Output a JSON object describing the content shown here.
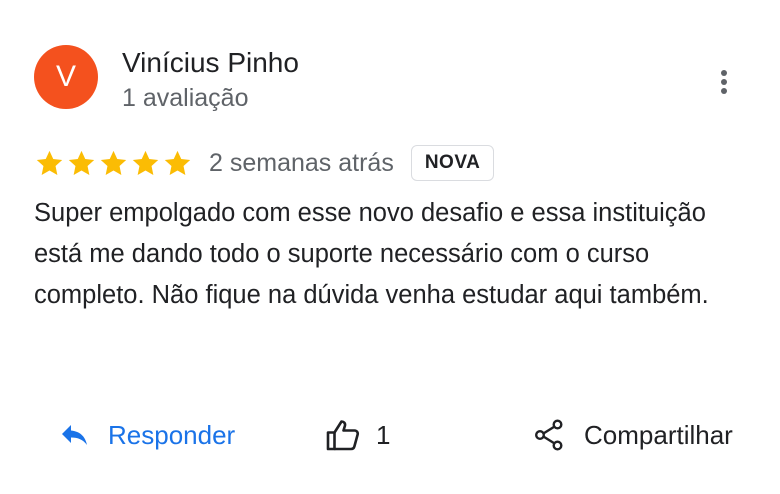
{
  "reviewer": {
    "avatar_initial": "V",
    "name": "Vinícius Pinho",
    "review_count": "1 avaliação",
    "avatar_color": "#f4511e"
  },
  "review": {
    "rating": 5,
    "rating_max": 5,
    "date": "2 semanas atrás",
    "badge": "NOVA",
    "text": "Super empolgado com esse novo desafio e essa instituição está me dando todo o suporte necessário com o curso completo. Não fique na dúvida venha estudar aqui também."
  },
  "actions": {
    "reply_label": "Responder",
    "like_count": "1",
    "share_label": "Compartilhar"
  },
  "icons": {
    "more": "more-vert-icon",
    "star": "star-icon",
    "reply": "reply-icon",
    "like": "thumb-up-icon",
    "share": "share-icon"
  },
  "colors": {
    "star": "#fbbc04",
    "reply": "#1a73e8",
    "secondary_text": "#5f6368"
  }
}
